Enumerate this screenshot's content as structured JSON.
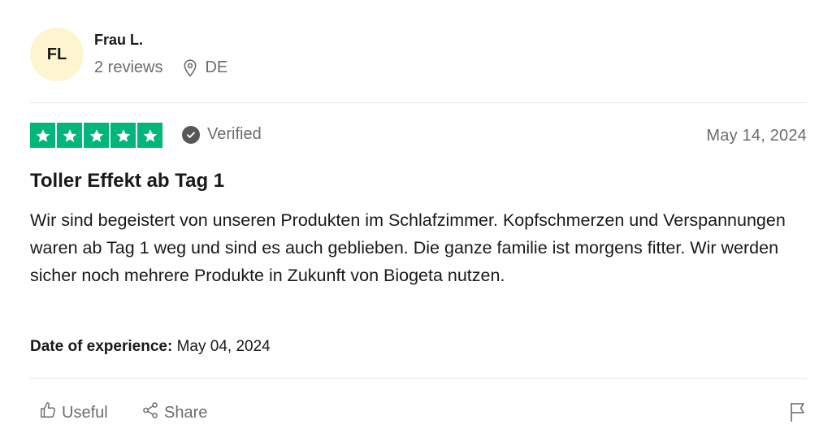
{
  "author": {
    "initials": "FL",
    "name": "Frau L.",
    "reviews": "2 reviews",
    "country": "DE"
  },
  "review": {
    "rating": 5,
    "rating_max": 5,
    "verified_label": "Verified",
    "date": "May 14, 2024",
    "title": "Toller Effekt ab Tag 1",
    "body": "Wir sind begeistert von unseren Produkten im Schlafzimmer. Kopfschmerzen und Verspannungen waren ab Tag 1 weg und sind es auch geblieben. Die ganze familie ist morgens fitter. Wir werden sicher noch mehrere Produkte in Zukunft von Biogeta nutzen.",
    "experience_label": "Date of experience:",
    "experience_date": "May 04, 2024"
  },
  "actions": {
    "useful_label": "Useful",
    "share_label": "Share"
  },
  "colors": {
    "star": "#00b67a",
    "avatar_bg": "#fcf5cf",
    "muted_text": "#6c6c6c",
    "divider": "#e5e5dd"
  },
  "icons": {
    "location": "location-pin-icon",
    "verified": "check-circle-icon",
    "useful": "thumbs-up-icon",
    "share": "share-icon",
    "report": "flag-icon"
  }
}
